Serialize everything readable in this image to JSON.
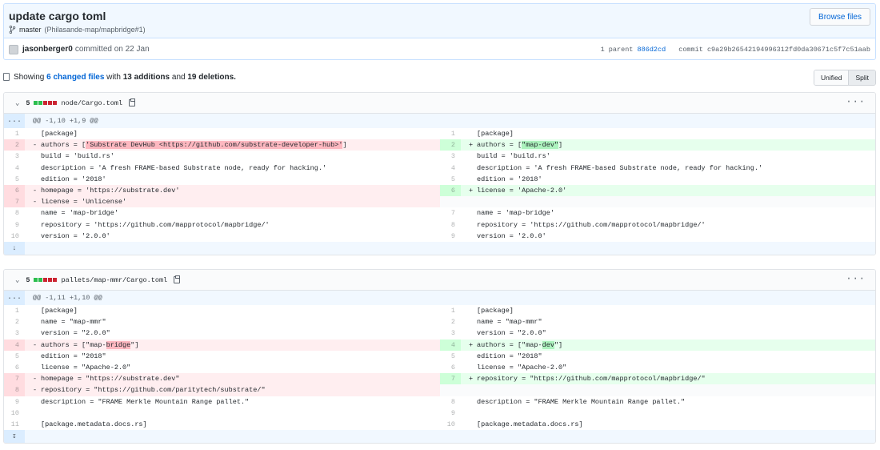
{
  "commit": {
    "title": "update cargo toml",
    "branch": "master",
    "ref": "(Philasande-map/mapbridge#1)",
    "browse_label": "Browse files",
    "author": "jasonberger0",
    "committed_text": "committed on 22 Jan",
    "parent_label": "1 parent",
    "parent_sha": "886d2cd",
    "commit_label": "commit",
    "commit_sha": "c9a29b26542194996312fd0da30671c5f7c51aab"
  },
  "toc": {
    "showing": "Showing",
    "changed_files": "6 changed files",
    "with": "with",
    "additions": "13 additions",
    "and": "and",
    "deletions": "19 deletions.",
    "unified_label": "Unified",
    "split_label": "Split"
  },
  "colors": {
    "accent": "#0366d6",
    "add": "#e6ffed",
    "del": "#ffeef0"
  },
  "files": [
    {
      "diffstat": "5",
      "blocks": [
        "g",
        "g",
        "r",
        "r",
        "r"
      ],
      "path": "node/Cargo.toml",
      "hunk": "@@ -1,10 +1,9 @@",
      "expand_top": "...",
      "expand_bottom": "↓",
      "rows": [
        {
          "l": {
            "n": "1",
            "t": "ctx",
            "s": [
              "[package]"
            ]
          },
          "r": {
            "n": "1",
            "t": "ctx",
            "s": [
              "[package]"
            ]
          }
        },
        {
          "l": {
            "n": "2",
            "t": "del",
            "s": [
              "authors = [",
              "'Substrate DevHub <https://github.com/substrate-developer-hub>'",
              "]"
            ]
          },
          "r": {
            "n": "2",
            "t": "add",
            "s": [
              "authors = [",
              "\"map-dev\"",
              "]"
            ]
          }
        },
        {
          "l": {
            "n": "3",
            "t": "ctx",
            "s": [
              "build = 'build.rs'"
            ]
          },
          "r": {
            "n": "3",
            "t": "ctx",
            "s": [
              "build = 'build.rs'"
            ]
          }
        },
        {
          "l": {
            "n": "4",
            "t": "ctx",
            "s": [
              "description = 'A fresh FRAME-based Substrate node, ready for hacking.'"
            ]
          },
          "r": {
            "n": "4",
            "t": "ctx",
            "s": [
              "description = 'A fresh FRAME-based Substrate node, ready for hacking.'"
            ]
          }
        },
        {
          "l": {
            "n": "5",
            "t": "ctx",
            "s": [
              "edition = '2018'"
            ]
          },
          "r": {
            "n": "5",
            "t": "ctx",
            "s": [
              "edition = '2018'"
            ]
          }
        },
        {
          "l": {
            "n": "6",
            "t": "del",
            "s": [
              "homepage = 'https://substrate.dev'"
            ]
          },
          "r": {
            "n": "6",
            "t": "add",
            "s": [
              "license = 'Apache-2.0'"
            ]
          }
        },
        {
          "l": {
            "n": "7",
            "t": "del",
            "s": [
              "license = 'Unlicense'"
            ]
          },
          "r": {
            "n": "",
            "t": "empty",
            "s": [
              ""
            ]
          }
        },
        {
          "l": {
            "n": "8",
            "t": "ctx",
            "s": [
              "name = 'map-bridge'"
            ]
          },
          "r": {
            "n": "7",
            "t": "ctx",
            "s": [
              "name = 'map-bridge'"
            ]
          }
        },
        {
          "l": {
            "n": "9",
            "t": "ctx",
            "s": [
              "repository = 'https://github.com/mapprotocol/mapbridge/'"
            ]
          },
          "r": {
            "n": "8",
            "t": "ctx",
            "s": [
              "repository = 'https://github.com/mapprotocol/mapbridge/'"
            ]
          }
        },
        {
          "l": {
            "n": "10",
            "t": "ctx",
            "s": [
              "version = '2.0.0'"
            ]
          },
          "r": {
            "n": "9",
            "t": "ctx",
            "s": [
              "version = '2.0.0'"
            ]
          }
        }
      ]
    },
    {
      "diffstat": "5",
      "blocks": [
        "g",
        "g",
        "r",
        "r",
        "r"
      ],
      "path": "pallets/map-mmr/Cargo.toml",
      "hunk": "@@ -1,11 +1,10 @@",
      "expand_top": "...",
      "expand_bottom": "↧",
      "rows": [
        {
          "l": {
            "n": "1",
            "t": "ctx",
            "s": [
              "[package]"
            ]
          },
          "r": {
            "n": "1",
            "t": "ctx",
            "s": [
              "[package]"
            ]
          }
        },
        {
          "l": {
            "n": "2",
            "t": "ctx",
            "s": [
              "name = \"map-mmr\""
            ]
          },
          "r": {
            "n": "2",
            "t": "ctx",
            "s": [
              "name = \"map-mmr\""
            ]
          }
        },
        {
          "l": {
            "n": "3",
            "t": "ctx",
            "s": [
              "version = \"2.0.0\""
            ]
          },
          "r": {
            "n": "3",
            "t": "ctx",
            "s": [
              "version = \"2.0.0\""
            ]
          }
        },
        {
          "l": {
            "n": "4",
            "t": "del",
            "s": [
              "authors = [\"map-",
              "bridge",
              "\"]"
            ]
          },
          "r": {
            "n": "4",
            "t": "add",
            "s": [
              "authors = [\"map-",
              "dev",
              "\"]"
            ]
          }
        },
        {
          "l": {
            "n": "5",
            "t": "ctx",
            "s": [
              "edition = \"2018\""
            ]
          },
          "r": {
            "n": "5",
            "t": "ctx",
            "s": [
              "edition = \"2018\""
            ]
          }
        },
        {
          "l": {
            "n": "6",
            "t": "ctx",
            "s": [
              "license = \"Apache-2.0\""
            ]
          },
          "r": {
            "n": "6",
            "t": "ctx",
            "s": [
              "license = \"Apache-2.0\""
            ]
          }
        },
        {
          "l": {
            "n": "7",
            "t": "del",
            "s": [
              "homepage = \"https://substrate.dev\""
            ]
          },
          "r": {
            "n": "7",
            "t": "add",
            "s": [
              "repository = \"https://github.com/mapprotocol/mapbridge/\""
            ]
          }
        },
        {
          "l": {
            "n": "8",
            "t": "del",
            "s": [
              "repository = \"https://github.com/paritytech/substrate/\""
            ]
          },
          "r": {
            "n": "",
            "t": "empty",
            "s": [
              ""
            ]
          }
        },
        {
          "l": {
            "n": "9",
            "t": "ctx",
            "s": [
              "description = \"FRAME Merkle Mountain Range pallet.\""
            ]
          },
          "r": {
            "n": "8",
            "t": "ctx",
            "s": [
              "description = \"FRAME Merkle Mountain Range pallet.\""
            ]
          }
        },
        {
          "l": {
            "n": "10",
            "t": "ctx",
            "s": [
              ""
            ]
          },
          "r": {
            "n": "9",
            "t": "ctx",
            "s": [
              ""
            ]
          }
        },
        {
          "l": {
            "n": "11",
            "t": "ctx",
            "s": [
              "[package.metadata.docs.rs]"
            ]
          },
          "r": {
            "n": "10",
            "t": "ctx",
            "s": [
              "[package.metadata.docs.rs]"
            ]
          }
        }
      ]
    }
  ]
}
